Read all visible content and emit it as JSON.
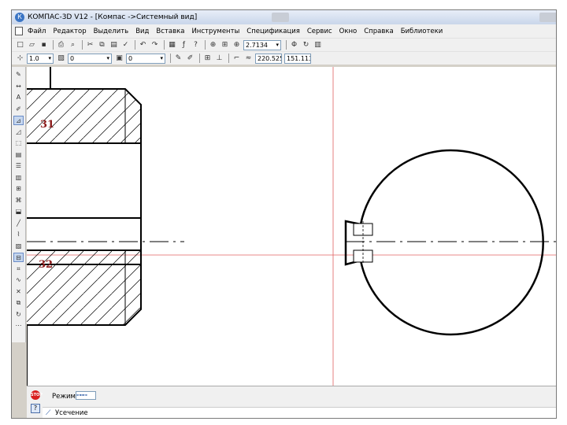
{
  "window": {
    "title": "КОМПАС-3D V12 - [Компас ->Системный вид]"
  },
  "menubar": {
    "items": [
      "Файл",
      "Редактор",
      "Выделить",
      "Вид",
      "Вставка",
      "Инструменты",
      "Спецификация",
      "Сервис",
      "Окно",
      "Справка",
      "Библиотеки"
    ]
  },
  "toolbar1": {
    "zoom_value": "2.7134"
  },
  "toolbar2": {
    "scale_value": "1.0",
    "layer_value": "0",
    "style_value": "0",
    "coord_x": "220.525",
    "coord_y": "151.113"
  },
  "canvas": {
    "point_labels": [
      "31",
      "32"
    ],
    "colors": {
      "geometry": "#000000",
      "construction": "#e06060",
      "label": "#8b1a1a"
    }
  },
  "bottom": {
    "mode_label": "Режим",
    "prompt_text": "Усечение",
    "icons": [
      "stop-icon",
      "help-icon",
      "trim-icon"
    ]
  }
}
